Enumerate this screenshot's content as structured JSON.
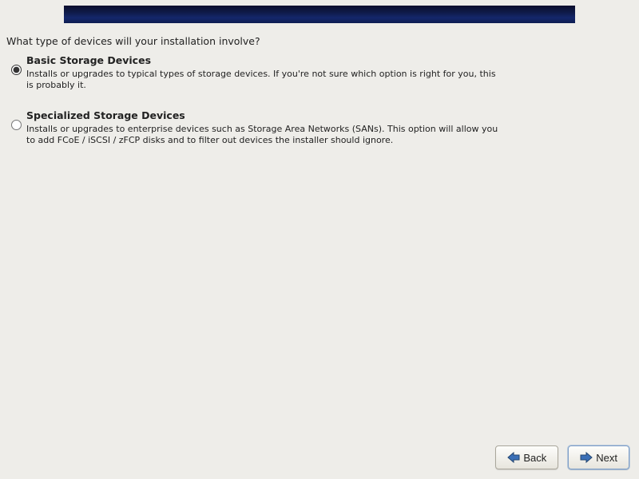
{
  "question": "What type of devices will your installation involve?",
  "options": {
    "basic": {
      "title": "Basic Storage Devices",
      "description": "Installs or upgrades to typical types of storage devices.  If you're not sure which option is right for you, this is probably it.",
      "selected": true
    },
    "specialized": {
      "title": "Specialized Storage Devices",
      "description": "Installs or upgrades to enterprise devices such as Storage Area Networks (SANs). This option will allow you to add FCoE / iSCSI / zFCP disks and to filter out devices the installer should ignore.",
      "selected": false
    }
  },
  "buttons": {
    "back": "Back",
    "next": "Next"
  }
}
